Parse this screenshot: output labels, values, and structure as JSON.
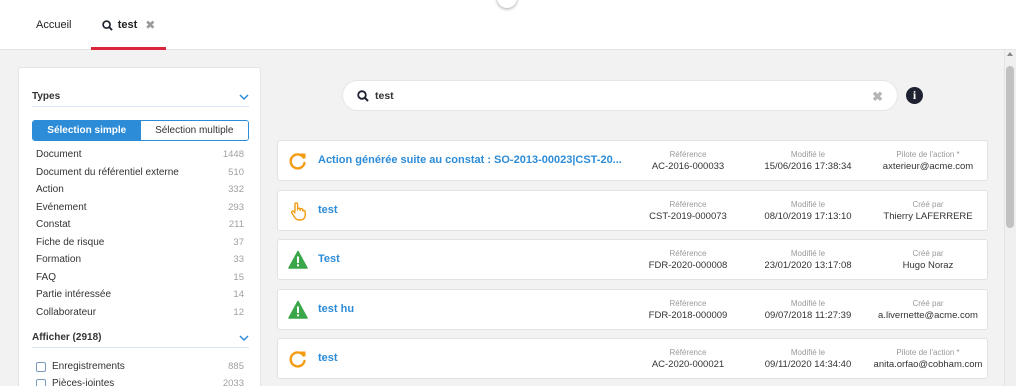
{
  "tabs": [
    {
      "label": "Accueil"
    },
    {
      "label": "test",
      "close": "✖"
    }
  ],
  "filters": {
    "types_title": "Types",
    "mode": {
      "simple": "Sélection simple",
      "multiple": "Sélection multiple"
    },
    "types": [
      {
        "label": "Document",
        "count": "1448"
      },
      {
        "label": "Document du référentiel externe",
        "count": "510"
      },
      {
        "label": "Action",
        "count": "332"
      },
      {
        "label": "Evénement",
        "count": "293"
      },
      {
        "label": "Constat",
        "count": "211"
      },
      {
        "label": "Fiche de risque",
        "count": "37"
      },
      {
        "label": "Formation",
        "count": "33"
      },
      {
        "label": "FAQ",
        "count": "15"
      },
      {
        "label": "Partie intéressée",
        "count": "14"
      },
      {
        "label": "Collaborateur",
        "count": "12"
      }
    ],
    "show_title": "Afficher (2918)",
    "show": [
      {
        "label": "Enregistrements",
        "count": "885"
      },
      {
        "label": "Pièces-jointes",
        "count": "2033"
      }
    ]
  },
  "search": {
    "value": "test",
    "clear": "✖"
  },
  "info": "i",
  "results": [
    {
      "icon": "refresh-icon",
      "title": "Action générée suite au constat : SO-2013-00023|CST-20...",
      "ref_label": "Référence",
      "ref": "AC-2016-000033",
      "mod_label": "Modifié le",
      "mod": "15/06/2016 17:38:34",
      "by_label": "Pilote de l'action *",
      "by": "axterieur@acme.com"
    },
    {
      "icon": "hand-pointer-icon",
      "title": "test",
      "ref_label": "Référence",
      "ref": "CST-2019-000073",
      "mod_label": "Modifié le",
      "mod": "08/10/2019 17:13:10",
      "by_label": "Créé par",
      "by": "Thierry LAFERRERE"
    },
    {
      "icon": "warning-icon",
      "title": "Test",
      "ref_label": "Référence",
      "ref": "FDR-2020-000008",
      "mod_label": "Modifié le",
      "mod": "23/01/2020 13:17:08",
      "by_label": "Créé par",
      "by": "Hugo Noraz"
    },
    {
      "icon": "warning-icon",
      "title": "test hu",
      "ref_label": "Référence",
      "ref": "FDR-2018-000009",
      "mod_label": "Modifié le",
      "mod": "09/07/2018 11:27:39",
      "by_label": "Créé par",
      "by": "a.livernette@acme.com"
    },
    {
      "icon": "refresh-icon",
      "title": "test",
      "ref_label": "Référence",
      "ref": "AC-2020-000021",
      "mod_label": "Modifié le",
      "mod": "09/11/2020 14:34:40",
      "by_label": "Pilote de l'action *",
      "by": "anita.orfao@cobham.com"
    }
  ],
  "colors": {
    "accent": "#2d8cd8",
    "tab_underline": "#d9263a",
    "warning": "#3aa64a",
    "action": "#f39c12"
  }
}
